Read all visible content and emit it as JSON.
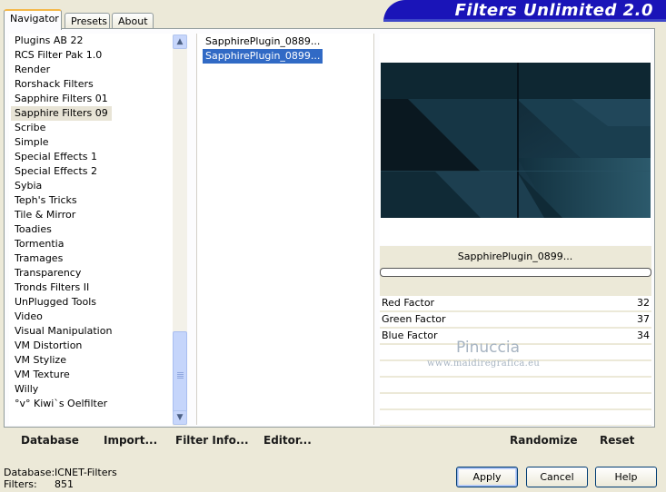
{
  "tabs": [
    {
      "label": "Navigator",
      "active": true
    },
    {
      "label": "Presets",
      "active": false
    },
    {
      "label": "About",
      "active": false
    }
  ],
  "brand": "Filters Unlimited 2.0",
  "categories": [
    "Plugins AB 22",
    "RCS Filter Pak 1.0",
    "Render",
    "Rorshack Filters",
    "Sapphire Filters 01",
    "Sapphire Filters 09",
    "Scribe",
    "Simple",
    "Special Effects 1",
    "Special Effects 2",
    "Sybia",
    "Teph's Tricks",
    "Tile & Mirror",
    "Toadies",
    "Tormentia",
    "Tramages",
    "Transparency",
    "Tronds Filters II",
    "UnPlugged Tools",
    "Video",
    "Visual Manipulation",
    "VM Distortion",
    "VM Stylize",
    "VM Texture",
    "Willy",
    "°v° Kiwi`s Oelfilter"
  ],
  "selected_category": "Sapphire Filters 09",
  "filters": [
    {
      "label": "SapphirePlugin_0889...",
      "selected": false
    },
    {
      "label": "SapphirePlugin_0899...",
      "selected": true
    }
  ],
  "current_filter": "SapphirePlugin_0899...",
  "params": [
    {
      "label": "Red Factor",
      "value": "32"
    },
    {
      "label": "Green Factor",
      "value": "37"
    },
    {
      "label": "Blue Factor",
      "value": "34"
    }
  ],
  "watermark": {
    "name": "Pinuccia",
    "url": "www.maidiregrafica.eu"
  },
  "actions": {
    "database": "Database",
    "import": "Import...",
    "filter_info": "Filter Info...",
    "editor": "Editor...",
    "randomize": "Randomize",
    "reset": "Reset"
  },
  "status": {
    "database_label": "Database:",
    "database_value": "ICNET-Filters",
    "filters_label": "Filters:",
    "filters_value": "851"
  },
  "buttons": {
    "apply": "Apply",
    "cancel": "Cancel",
    "help": "Help"
  },
  "colors": {
    "selection": "#316ac5",
    "brand_banner": "#1a14b8",
    "scroll_thumb": "#c5d5fb"
  }
}
